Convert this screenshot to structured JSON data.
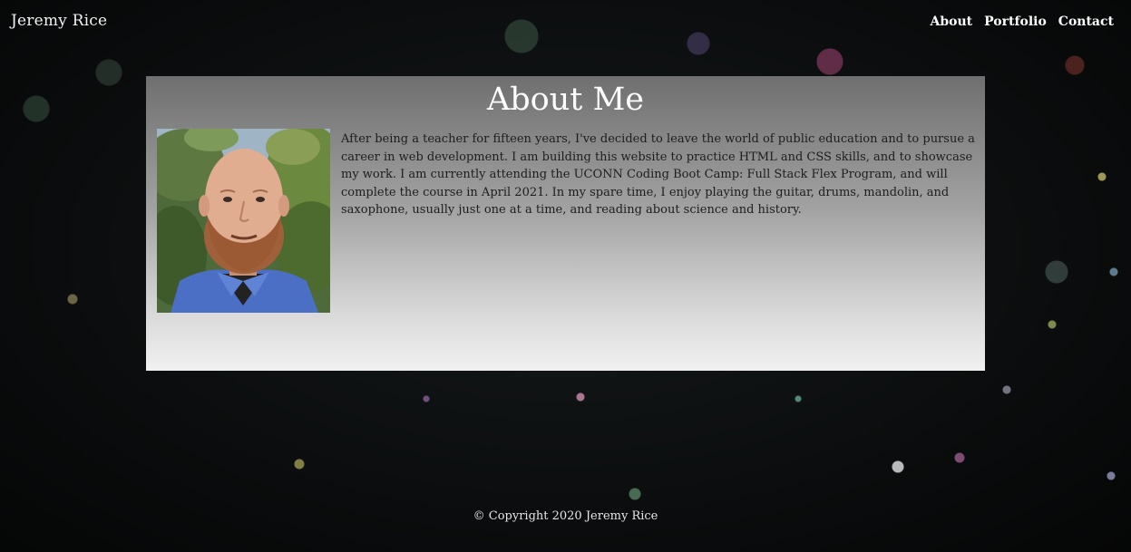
{
  "header": {
    "brand": "Jeremy Rice",
    "nav": [
      "About",
      "Portfolio",
      "Contact"
    ]
  },
  "about": {
    "title": "About Me",
    "portrait_desc": "portrait",
    "text": "After being a teacher for fifteen years, I've decided to leave the world of public education and to pursue a career in web development. I am building this website to practice HTML and CSS skills, and to showcase my work. I am currently attending the UCONN Coding Boot Camp: Full Stack Flex Program, and will complete the course in April 2021. In my spare time, I enjoy playing the guitar, drums, mandolin, and saxophone, usually just one at a time, and reading about science and history."
  },
  "footer": {
    "copyright": "© Copyright 2020 Jeremy Rice"
  },
  "colors": {
    "card_top": "#6f6f6f",
    "card_bottom": "#f1f1f1",
    "background": "#0a0c0d"
  }
}
